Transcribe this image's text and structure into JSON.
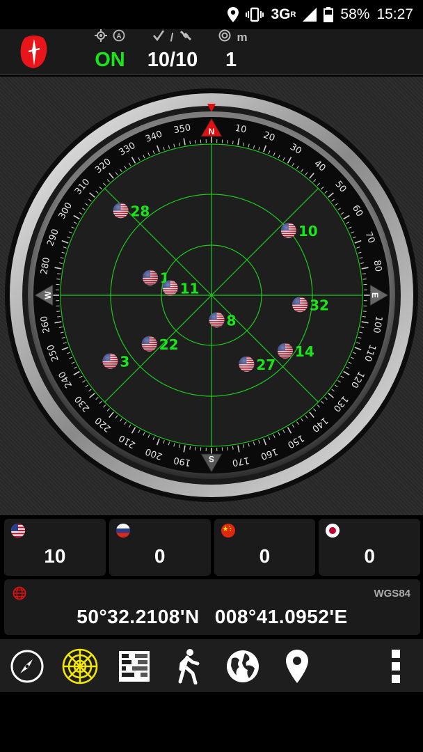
{
  "status_bar": {
    "network": "3G",
    "network_sup": "R",
    "battery": "58%",
    "time": "15:27"
  },
  "header": {
    "gps_state": "ON",
    "sats_used": "10/10",
    "accuracy": "1",
    "accuracy_unit": "m"
  },
  "radar": {
    "cardinals": {
      "north": "N",
      "east": "E",
      "south": "S",
      "west": "W"
    },
    "degree_labels": [
      "10",
      "20",
      "30",
      "40",
      "50",
      "60",
      "70",
      "80",
      "100",
      "110",
      "120",
      "130",
      "140",
      "150",
      "160",
      "170",
      "190",
      "200",
      "210",
      "220",
      "230",
      "240",
      "250",
      "260",
      "280",
      "290",
      "300",
      "310",
      "320",
      "330",
      "340",
      "350"
    ],
    "satellites": [
      {
        "prn": "28",
        "constellation": "usa-flag",
        "azimuth": 313,
        "elevation": 16
      },
      {
        "prn": "10",
        "constellation": "usa-flag",
        "azimuth": 50,
        "elevation": 30
      },
      {
        "prn": "1",
        "constellation": "usa-flag",
        "azimuth": 286,
        "elevation": 52
      },
      {
        "prn": "11",
        "constellation": "usa-flag",
        "azimuth": 280,
        "elevation": 65
      },
      {
        "prn": "32",
        "constellation": "usa-flag",
        "azimuth": 96,
        "elevation": 37
      },
      {
        "prn": "8",
        "constellation": "usa-flag",
        "azimuth": 168,
        "elevation": 75
      },
      {
        "prn": "22",
        "constellation": "usa-flag",
        "azimuth": 232,
        "elevation": 43
      },
      {
        "prn": "14",
        "constellation": "usa-flag",
        "azimuth": 127,
        "elevation": 35
      },
      {
        "prn": "3",
        "constellation": "usa-flag",
        "azimuth": 237,
        "elevation": 18
      },
      {
        "prn": "27",
        "constellation": "usa-flag",
        "azimuth": 153,
        "elevation": 44
      }
    ]
  },
  "constellations": [
    {
      "flag": "usa-flag",
      "count": "10"
    },
    {
      "flag": "russia-flag",
      "count": "0"
    },
    {
      "flag": "china-flag",
      "count": "0"
    },
    {
      "flag": "japan-flag",
      "count": "0"
    }
  ],
  "location": {
    "datum": "WGS84",
    "latitude": "50°32.2108'N",
    "longitude": "008°41.0952'E"
  },
  "toolbar": {
    "items": [
      "compass-icon",
      "radar-icon",
      "signal-bars-icon",
      "walking-icon",
      "globe-icon",
      "map-pin-icon",
      "more-vert-icon"
    ]
  },
  "colors": {
    "accent_green": "#19e619",
    "north_red": "#e01010",
    "logo_red": "#e8161b"
  }
}
